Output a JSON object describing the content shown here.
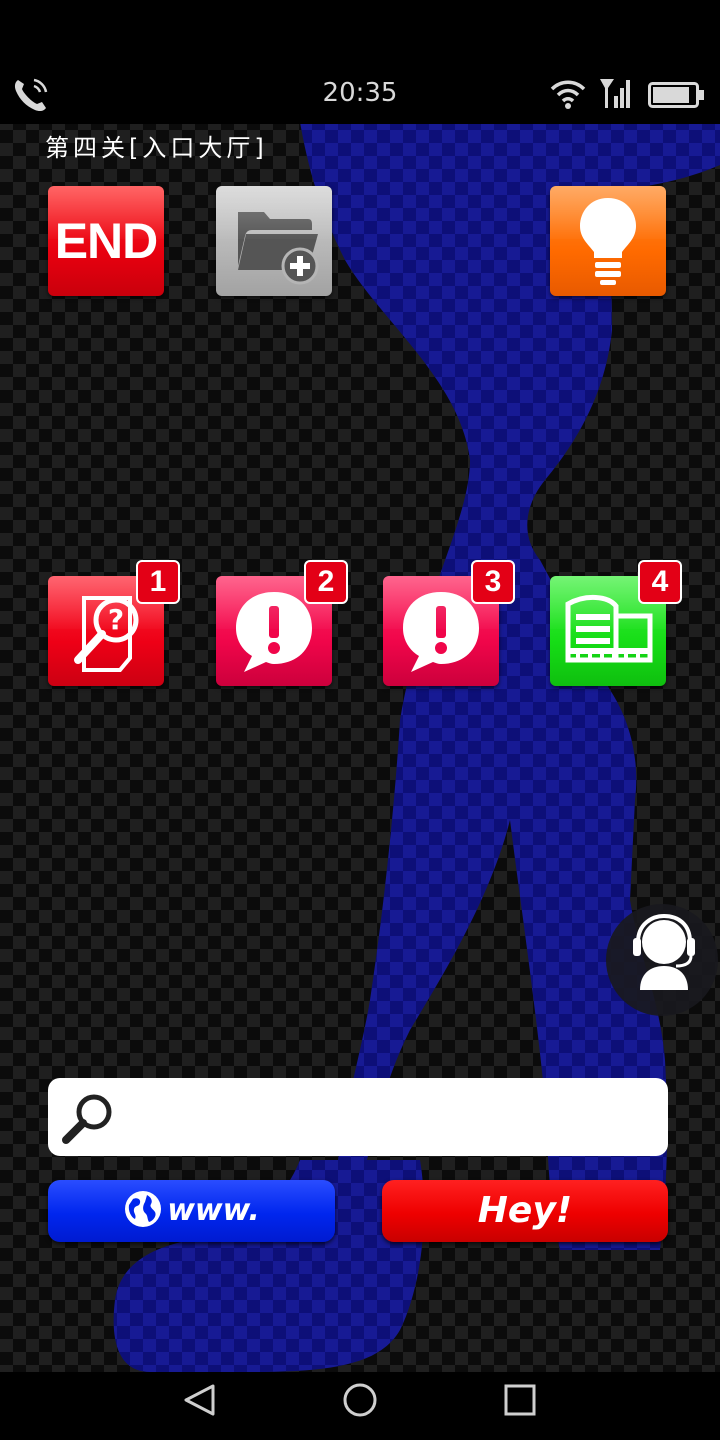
{
  "status_bar": {
    "time": "20:35",
    "left_icon": "phone-call-icon",
    "right_icons": [
      "wifi-icon",
      "signal-icon",
      "battery-icon"
    ]
  },
  "level": {
    "title": "第四关[入口大厅]"
  },
  "top_row": [
    {
      "name": "end-button",
      "label": "END",
      "color": "#e8000f"
    },
    {
      "name": "add-folder-button",
      "icon": "folder-add-icon",
      "color": "#b5b5b5"
    },
    {
      "name": "hint-button",
      "icon": "lightbulb-icon",
      "color": "#ff6a00"
    }
  ],
  "apps": [
    {
      "name": "app-question",
      "icon": "question-document-icon",
      "badge": "1",
      "color": "#ee0016"
    },
    {
      "name": "app-alert-a",
      "icon": "exclamation-bubble-icon",
      "badge": "2",
      "color": "#f0054a"
    },
    {
      "name": "app-alert-b",
      "icon": "exclamation-bubble-icon",
      "badge": "3",
      "color": "#f0054a"
    },
    {
      "name": "app-building",
      "icon": "building-icon",
      "badge": "4",
      "color": "#16dd16"
    }
  ],
  "search": {
    "icon": "search-icon",
    "placeholder": "",
    "value": ""
  },
  "buttons": {
    "www_label": "www.",
    "www_icon": "globe-icon",
    "hey_label": "Hey!"
  },
  "assistant": {
    "icon": "headset-agent-icon"
  },
  "nav": {
    "icons": [
      "back-icon",
      "home-icon",
      "recents-icon"
    ]
  },
  "colors": {
    "silhouette": "#0d0f7a",
    "www_button": "#0026ee",
    "hey_button": "#ee0000",
    "badge": "#e30016"
  }
}
